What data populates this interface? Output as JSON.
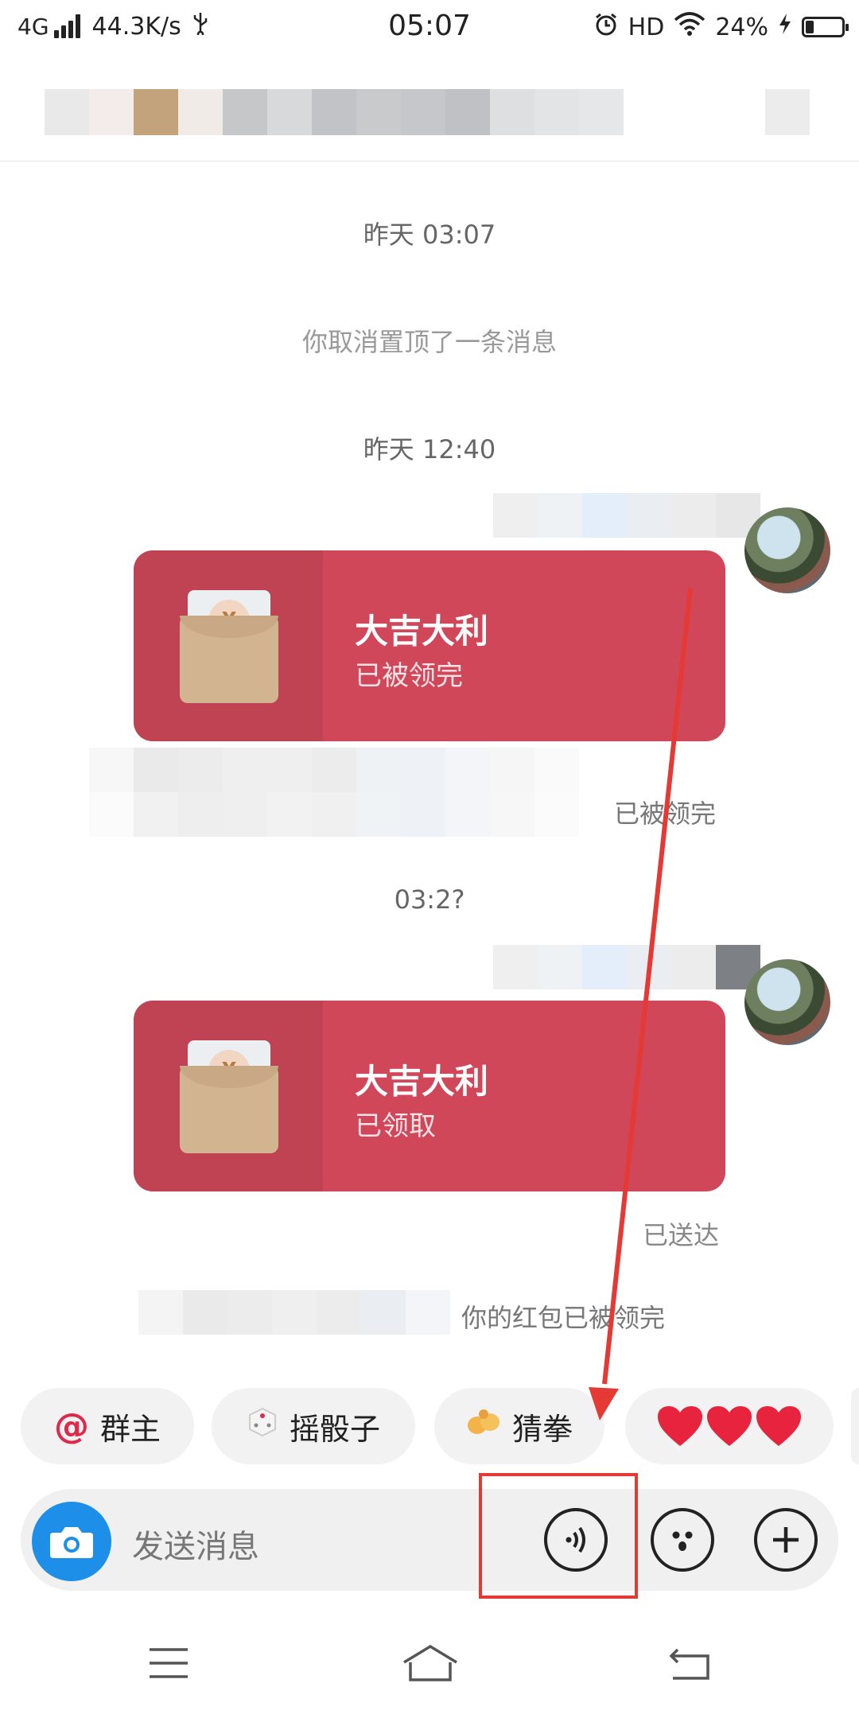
{
  "status_bar": {
    "network": "4G",
    "speed": "44.3K/s",
    "time": "05:07",
    "hd": "HD",
    "battery": "24%",
    "battery_level": 0.24
  },
  "messages": {
    "time1": "昨天 03:07",
    "system_unpin": "你取消置顶了一条消息",
    "time2": "昨天 12:40",
    "packet1": {
      "title": "大吉大利",
      "status": "已被领完"
    },
    "notice1_suffix": "已被领完",
    "time3": "03:2?",
    "packet2": {
      "title": "大吉大利",
      "status": "已领取"
    },
    "delivered": "已送达",
    "notice2_suffix": "你的红包已被领完"
  },
  "quick_chips": [
    {
      "label": "群主",
      "icon": "at-icon"
    },
    {
      "label": "摇骰子",
      "icon": "dice-icon"
    },
    {
      "label": "猜拳",
      "icon": "fist-icon"
    },
    {
      "label": "❤❤❤",
      "icon": "hearts"
    }
  ],
  "input": {
    "placeholder": "发送消息"
  },
  "colors": {
    "red_packet": "#d0475a",
    "camera_blue": "#1e8fe8",
    "annotation_red": "#e53935"
  }
}
